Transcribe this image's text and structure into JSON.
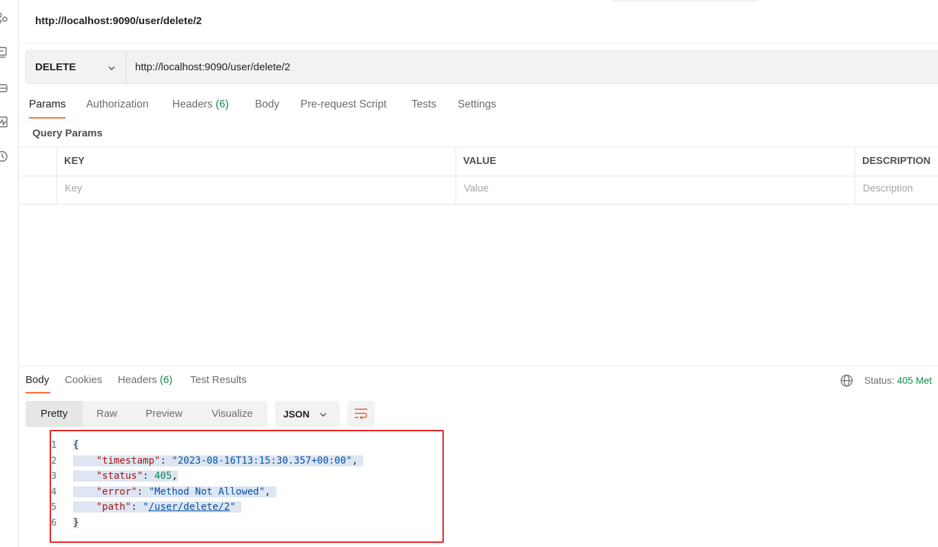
{
  "tab": {
    "title": "http://localhost:9090/user/delete/2"
  },
  "request": {
    "method": "DELETE",
    "url": "http://localhost:9090/user/delete/2"
  },
  "request_tabs": [
    {
      "label": "Params",
      "active": true
    },
    {
      "label": "Authorization"
    },
    {
      "label": "Headers",
      "count": "(6)"
    },
    {
      "label": "Body"
    },
    {
      "label": "Pre-request Script"
    },
    {
      "label": "Tests"
    },
    {
      "label": "Settings"
    }
  ],
  "query_params": {
    "title": "Query Params",
    "columns": [
      "KEY",
      "VALUE",
      "DESCRIPTION"
    ],
    "placeholders": [
      "Key",
      "Value",
      "Description"
    ]
  },
  "response_tabs": [
    {
      "label": "Body",
      "active": true
    },
    {
      "label": "Cookies"
    },
    {
      "label": "Headers",
      "count": "(6)"
    },
    {
      "label": "Test Results"
    }
  ],
  "status": {
    "label": "Status:",
    "value": "405 Met"
  },
  "view_modes": [
    {
      "label": "Pretty",
      "active": true
    },
    {
      "label": "Raw"
    },
    {
      "label": "Preview"
    },
    {
      "label": "Visualize"
    }
  ],
  "format": "JSON",
  "response_body": {
    "line_numbers": [
      "1",
      "2",
      "3",
      "4",
      "5",
      "6"
    ],
    "open_brace": "{",
    "close_brace": "}",
    "fields": [
      {
        "key": "\"timestamp\"",
        "value": "\"2023-08-16T13:15:30.357+00:00\""
      },
      {
        "key": "\"status\"",
        "value": "405"
      },
      {
        "key": "\"error\"",
        "value": "\"Method Not Allowed\""
      },
      {
        "key": "\"path\"",
        "value": "/user/delete/2"
      }
    ]
  },
  "colors": {
    "accent": "#ff6c37",
    "count_green": "#0f8a4a",
    "highlight_box": "#e8201f",
    "json_key": "#a31515",
    "json_string": "#0451a5",
    "json_number": "#098658"
  },
  "icons": [
    "apis-icon",
    "environments-icon",
    "mock-servers-icon",
    "monitors-icon",
    "history-icon",
    "chevron-down-icon",
    "globe-icon",
    "wrap-lines-icon"
  ]
}
